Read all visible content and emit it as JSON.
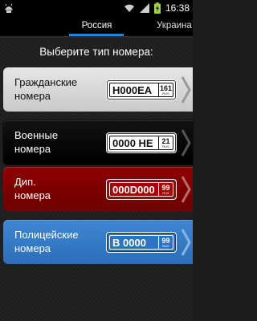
{
  "status_bar": {
    "time": "16:38",
    "left_icon": "usb-debug-icon",
    "icons": [
      "wifi-icon",
      "signal-icon",
      "battery-charging-icon"
    ]
  },
  "tabs": [
    {
      "label": "Россия",
      "active": true
    },
    {
      "label": "Украина",
      "active": false
    }
  ],
  "prompt": "Выберите тип номера:",
  "plate_types": [
    {
      "label": "Гражданские\nномера",
      "plate_main": "Н000ЕА",
      "plate_region": "161",
      "plate_rus": "RUS"
    },
    {
      "label": "Военные\nномера",
      "plate_main": "0000 НЕ",
      "plate_region": "21",
      "plate_rus": "RUS"
    },
    {
      "label": "Дип.\nномера",
      "plate_main": "000D000",
      "plate_region": "99",
      "plate_rus": "RUS"
    },
    {
      "label": "Полицейские\nномера",
      "plate_main": "В 0000",
      "plate_region": "99",
      "plate_rus": "RUS"
    }
  ],
  "colors": {
    "tab_accent": "#2d7fd1",
    "civil": "#d9d9d9",
    "military": "#0a0a0a",
    "diplomatic": "#7e0000",
    "police": "#357ac6"
  }
}
